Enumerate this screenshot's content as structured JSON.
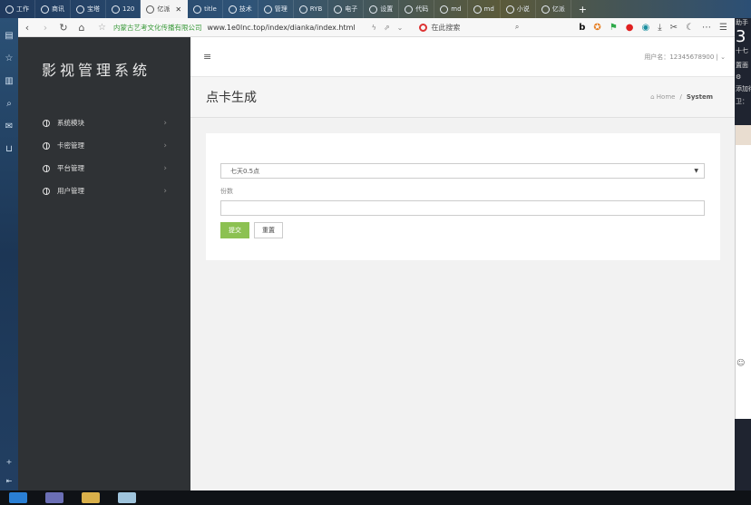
{
  "browser": {
    "tabs": [
      {
        "label": "工作",
        "active": false
      },
      {
        "label": "商讯",
        "active": false
      },
      {
        "label": "宝塔",
        "active": false
      },
      {
        "label": "120",
        "active": false
      },
      {
        "label": "亿派",
        "active": true
      },
      {
        "label": "title",
        "active": false
      },
      {
        "label": "技术",
        "active": false
      },
      {
        "label": "管理",
        "active": false
      },
      {
        "label": "RYB",
        "active": false
      },
      {
        "label": "电子",
        "active": false
      },
      {
        "label": "设置",
        "active": false
      },
      {
        "label": "代码",
        "active": false
      },
      {
        "label": "md",
        "active": false
      },
      {
        "label": "md",
        "active": false
      },
      {
        "label": "小说",
        "active": false
      },
      {
        "label": "亿派",
        "active": false
      }
    ],
    "site_name": "内蒙古艺考文化传播有限公司",
    "url": "www.1e0lnc.top/index/dianka/index.html",
    "search_placeholder": "在此搜索"
  },
  "app": {
    "brand": "影视管理系统",
    "menu": [
      {
        "label": "系统模块"
      },
      {
        "label": "卡密管理"
      },
      {
        "label": "平台管理"
      },
      {
        "label": "用户管理"
      }
    ],
    "user_label": "用户名：",
    "user_name": "12345678900",
    "page_title": "点卡生成",
    "breadcrumb": {
      "home": "Home",
      "sep": "/",
      "current": "System"
    },
    "form": {
      "select_value": "七天0.5点",
      "count_label": "份数",
      "count_value": "",
      "submit_label": "提交",
      "reset_label": "重置"
    }
  },
  "right_panel": {
    "lines": [
      "助手",
      "3",
      "十七",
      "置面",
      "添加待",
      "卫："
    ]
  },
  "colors": {
    "accent_green": "#8cc152",
    "sidebar_bg": "#2f3235",
    "site_green": "#3a9a3a"
  }
}
